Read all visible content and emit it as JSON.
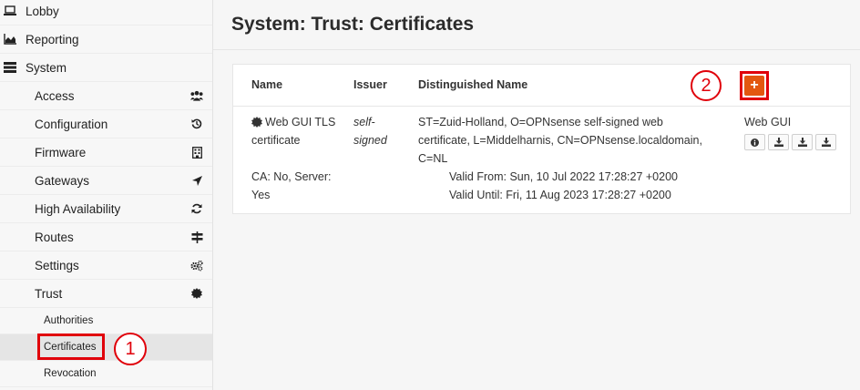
{
  "sidebar": {
    "lobby": "Lobby",
    "reporting": "Reporting",
    "system": "System",
    "items": [
      {
        "label": "Access",
        "icon": "users-icon"
      },
      {
        "label": "Configuration",
        "icon": "history-icon"
      },
      {
        "label": "Firmware",
        "icon": "building-icon"
      },
      {
        "label": "Gateways",
        "icon": "location-arrow-icon"
      },
      {
        "label": "High Availability",
        "icon": "refresh-icon"
      },
      {
        "label": "Routes",
        "icon": "map-signs-icon"
      },
      {
        "label": "Settings",
        "icon": "cogs-icon"
      },
      {
        "label": "Trust",
        "icon": "certificate-icon"
      }
    ],
    "trust_children": [
      "Authorities",
      "Certificates",
      "Revocation"
    ]
  },
  "annotations": {
    "one": "1",
    "two": "2"
  },
  "page": {
    "title": "System: Trust: Certificates"
  },
  "table": {
    "headers": {
      "name": "Name",
      "issuer": "Issuer",
      "dn": "Distinguished Name"
    },
    "add_label": "+",
    "row": {
      "name_line1": "Web GUI TLS",
      "name_line2": "certificate",
      "ca_line1": "CA: No, Server:",
      "ca_line2": "Yes",
      "issuer_line1": "self-",
      "issuer_line2": "signed",
      "dn_line1": "ST=Zuid-Holland, O=OPNsense self-signed web",
      "dn_line2": "certificate, L=Middelharnis, CN=OPNsense.localdomain,",
      "dn_line3": "C=NL",
      "valid_from": "Valid From: Sun, 10 Jul 2022 17:28:27 +0200",
      "valid_until": "Valid Until:  Fri, 11 Aug 2023 17:28:27 +0200",
      "in_use": "Web GUI"
    }
  },
  "colors": {
    "accent": "#e3570f",
    "highlight": "#e0000a"
  }
}
